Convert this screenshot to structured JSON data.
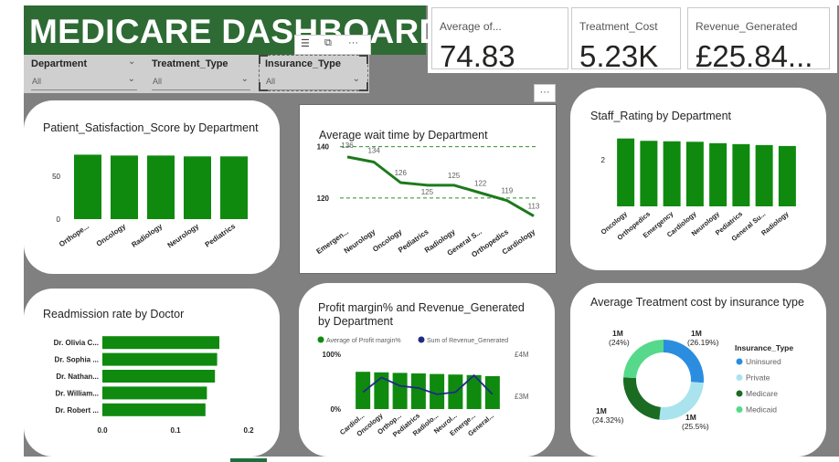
{
  "header": {
    "title": "MEDICARE DASHBOARD"
  },
  "kpis": [
    {
      "label": "Average of...",
      "value": "74.83"
    },
    {
      "label": "Treatment_Cost",
      "value": "5.23K"
    },
    {
      "label": "Revenue_Generated",
      "value": "£25.84..."
    }
  ],
  "slicers": [
    {
      "title": "Department",
      "value": "All"
    },
    {
      "title": "Treatment_Type",
      "value": "All"
    },
    {
      "title": "Insurance_Type",
      "value": "All"
    }
  ],
  "icons": {
    "filter": "filter-icon",
    "focus": "focus-mode-icon",
    "more": "more-options-icon",
    "chevron": "chevron-down-icon"
  },
  "colors": {
    "bar": "#0f8a0f",
    "line_dark": "#1c7a1c",
    "navy": "#1f2a86",
    "title_bg": "#2e6b34",
    "canvas": "#808080"
  },
  "chart_data": [
    {
      "type": "bar",
      "title": "Patient_Satisfaction_Score by Department",
      "categories": [
        "Orthope...",
        "Oncology",
        "Radiology",
        "Neurology",
        "Pediatrics"
      ],
      "values": [
        75,
        74,
        74,
        73,
        73
      ],
      "yticks": [
        "0",
        "50"
      ],
      "ylim": [
        0,
        85
      ]
    },
    {
      "type": "line",
      "title": "Average wait time by Department",
      "categories": [
        "Emergen...",
        "Neurology",
        "Oncology",
        "Pediatrics",
        "Radiology",
        "General S...",
        "Orthopedics",
        "Cardiology"
      ],
      "values": [
        136,
        134,
        126,
        125,
        125,
        122,
        119,
        113
      ],
      "labels": [
        "136",
        "134",
        "126",
        "125",
        "125",
        "122",
        "119",
        "113"
      ],
      "yticks": [
        "120",
        "140"
      ],
      "ylim": [
        110,
        142
      ],
      "reference_lines": [
        120,
        140
      ]
    },
    {
      "type": "bar",
      "title": "Staff_Rating by Department",
      "categories": [
        "Oncology",
        "Orthopedics",
        "Emergency",
        "Cardiology",
        "Neurology",
        "Pediatrics",
        "General Su...",
        "Radiology"
      ],
      "values": [
        2.9,
        2.8,
        2.78,
        2.76,
        2.7,
        2.66,
        2.62,
        2.58
      ],
      "yticks": [
        "2"
      ],
      "ylim": [
        0,
        3.2
      ]
    },
    {
      "type": "bar",
      "orientation": "horizontal",
      "title": "Readmission rate by Doctor",
      "categories": [
        "Dr. Olivia C...",
        "Dr. Sophia ...",
        "Dr. Nathan...",
        "Dr. William...",
        "Dr. Robert ..."
      ],
      "values": [
        0.16,
        0.157,
        0.154,
        0.143,
        0.141
      ],
      "xticks": [
        "0.0",
        "0.1",
        "0.2"
      ],
      "xlim": [
        0,
        0.2
      ]
    },
    {
      "type": "bar",
      "title": "Profit margin% and Revenue_Generated by Department",
      "legend": [
        "Average of Profit margin%",
        "Sum of Revenue_Generated"
      ],
      "categories": [
        "Cardiol...",
        "Oncology",
        "Orthop...",
        "Pediatrics",
        "Radiolo...",
        "Neurol...",
        "Emerge...",
        "General..."
      ],
      "series": [
        {
          "name": "Average of Profit margin%",
          "values": [
            68,
            67,
            66,
            65,
            64,
            63,
            62,
            60
          ]
        },
        {
          "name": "Sum of Revenue_Generated",
          "values": [
            3.1,
            3.45,
            3.25,
            3.2,
            3.05,
            3.1,
            3.5,
            3.05
          ]
        }
      ],
      "yticks_left": [
        "0%",
        "100%"
      ],
      "yticks_right": [
        "£3M",
        "£4M"
      ]
    },
    {
      "type": "pie",
      "title": "Average Treatment cost by insurance type",
      "legend_title": "Insurance_Type",
      "series": [
        {
          "name": "Uninsured",
          "value": 26.19,
          "label1": "1M",
          "label2": "(26.19%)",
          "color": "#2b8de0"
        },
        {
          "name": "Private",
          "value": 25.5,
          "label1": "1M",
          "label2": "(25.5%)",
          "color": "#a9e4ee"
        },
        {
          "name": "Medicare",
          "value": 24.32,
          "label1": "1M",
          "label2": "(24.32%)",
          "color": "#1b6b23"
        },
        {
          "name": "Medicaid",
          "value": 24,
          "label1": "1M",
          "label2": "(24%)",
          "color": "#56d98b"
        }
      ]
    }
  ]
}
